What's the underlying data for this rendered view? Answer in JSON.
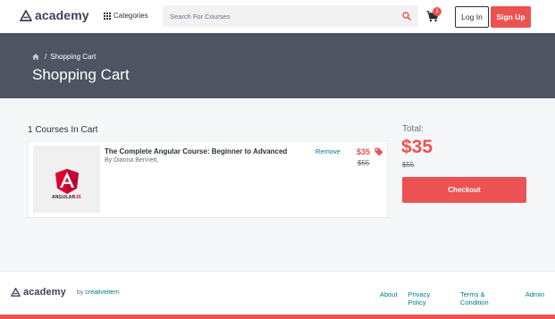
{
  "brand": {
    "name": "academy"
  },
  "header": {
    "categories_label": "Categories",
    "search_placeholder": "Search For Courses",
    "cart_count": "1",
    "login_label": "Log In",
    "signup_label": "Sign Up"
  },
  "banner": {
    "breadcrumb_current": "Shopping Cart",
    "title": "Shopping Cart"
  },
  "cart": {
    "count_label": "1 Courses In Cart",
    "items": [
      {
        "title": "The Complete Angular Course: Beginner to Advanced",
        "author": "By Dianna Bennett,",
        "remove_label": "Remove",
        "price": "$35",
        "original_price": "$55",
        "thumbnail_logo_text_dark": "ANGULAR",
        "thumbnail_logo_text_accent": "JS"
      }
    ]
  },
  "summary": {
    "total_label": "Total:",
    "total_price": "$35",
    "original_total": "$55",
    "checkout_label": "Checkout"
  },
  "footer": {
    "by_prefix": "by",
    "by_author": "creativeitem",
    "links": [
      "About",
      "Privacy Policy",
      "Terms & Condition",
      "Admin"
    ]
  },
  "colors": {
    "accent": "#ec5252",
    "banner": "#4e5462",
    "link": "#007791",
    "text": "#29303b"
  },
  "icons": [
    "academy-logo-icon",
    "grid-icon",
    "search-icon",
    "cart-icon",
    "home-icon",
    "tag-icon",
    "angular-logo-icon"
  ]
}
